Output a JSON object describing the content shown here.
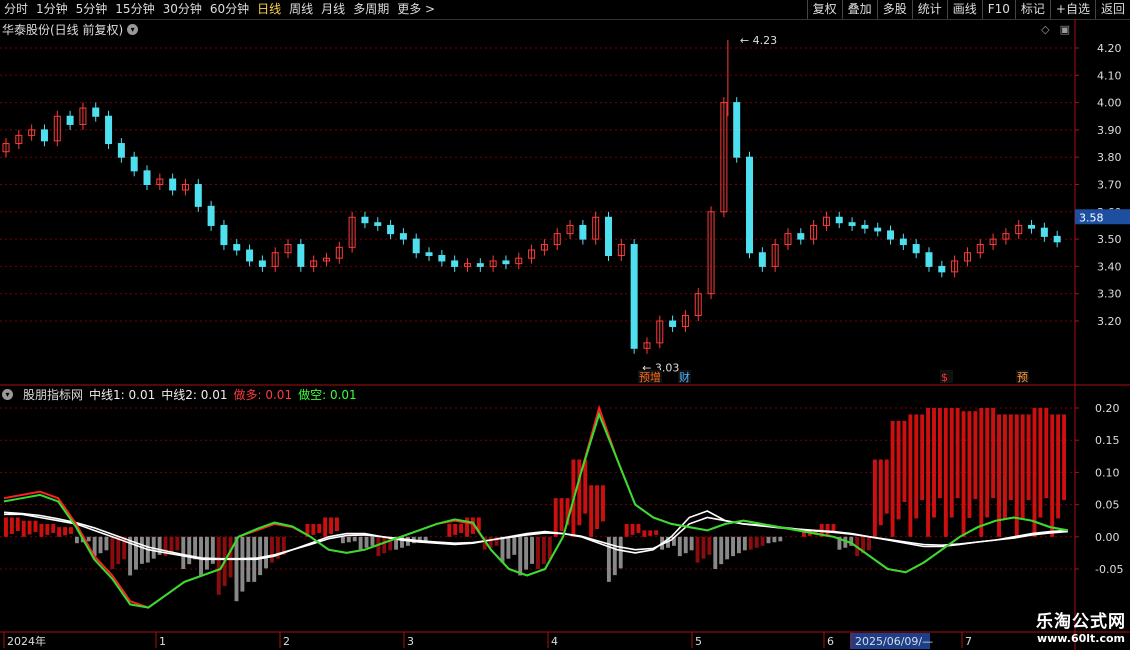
{
  "toolbar": {
    "periods": [
      "分时",
      "1分钟",
      "5分钟",
      "15分钟",
      "30分钟",
      "60分钟",
      "日线",
      "周线",
      "月线",
      "多周期",
      "更多 >"
    ],
    "active_period": "日线",
    "right_buttons": [
      "复权",
      "叠加",
      "多股",
      "统计",
      "画线",
      "F10",
      "标记",
      "+自选",
      "返回"
    ]
  },
  "stock": {
    "title": "华泰股份(日线 前复权)",
    "high_label": "4.23",
    "low_label": "3.03",
    "price_tag": "3.58",
    "event_labels": [
      "预增",
      "财",
      "$",
      "预"
    ],
    "price_axis": [
      "4.20",
      "4.10",
      "4.00",
      "3.90",
      "3.80",
      "3.70",
      "3.60",
      "3.50",
      "3.40",
      "3.30",
      "3.20"
    ]
  },
  "indicator": {
    "name": "股朋指标网",
    "legend": [
      {
        "label": "中线1:",
        "value": "0.01"
      },
      {
        "label": "中线2:",
        "value": "0.01"
      },
      {
        "label": "做多:",
        "value": "0.01"
      },
      {
        "label": "做空:",
        "value": "0.01"
      }
    ],
    "axis": [
      "0.20",
      "0.15",
      "0.10",
      "0.05",
      "0.00",
      "-0.05"
    ]
  },
  "time_axis": {
    "labels": [
      "2024年",
      "1",
      "2",
      "3",
      "4",
      "5",
      "6",
      "2025/06/09/—",
      "7"
    ]
  },
  "watermark": {
    "line1": "乐淘公式网",
    "line2": "www.60lt.com"
  },
  "colors": {
    "up": "#ff3b3b",
    "down": "#4fe0f0",
    "grid": "#7a0000",
    "white_line": "#ffffff",
    "red_line": "#ff2020",
    "green_line": "#30e030",
    "bar_red": "#cc1010",
    "bar_grey": "#888888",
    "dark_red": "#8a0d0d"
  },
  "chart_data": {
    "type": "candlestick",
    "x_axis_ticks": [
      "2024年",
      "1",
      "2",
      "3",
      "4",
      "5",
      "6",
      "7"
    ],
    "price_ylim": [
      3.03,
      4.23
    ],
    "high": 4.23,
    "low": 3.03,
    "last_price": 3.58,
    "close_series": [
      3.85,
      3.88,
      3.9,
      3.86,
      3.95,
      3.92,
      3.98,
      3.95,
      3.85,
      3.8,
      3.75,
      3.7,
      3.72,
      3.68,
      3.7,
      3.62,
      3.55,
      3.48,
      3.46,
      3.42,
      3.4,
      3.45,
      3.48,
      3.4,
      3.42,
      3.43,
      3.47,
      3.58,
      3.56,
      3.55,
      3.52,
      3.5,
      3.45,
      3.44,
      3.42,
      3.4,
      3.41,
      3.4,
      3.42,
      3.41,
      3.43,
      3.46,
      3.48,
      3.52,
      3.55,
      3.5,
      3.58,
      3.44,
      3.48,
      3.1,
      3.12,
      3.2,
      3.18,
      3.22,
      3.3,
      3.6,
      4.0,
      3.8,
      3.45,
      3.4,
      3.48,
      3.52,
      3.5,
      3.55,
      3.58,
      3.56,
      3.55,
      3.54,
      3.53,
      3.5,
      3.48,
      3.45,
      3.4,
      3.38,
      3.42,
      3.45,
      3.48,
      3.5,
      3.52,
      3.55,
      3.54,
      3.51,
      3.49
    ],
    "indicator": {
      "ylim": [
        -0.08,
        0.22
      ],
      "series": [
        {
          "name": "中线1",
          "values": [
            0.035,
            0.035,
            0.03,
            0.025,
            0.02,
            0.01,
            0.0,
            -0.01,
            -0.02,
            -0.025,
            -0.03,
            -0.035,
            -0.035,
            -0.035,
            -0.035,
            -0.03,
            -0.02,
            -0.01,
            0.0,
            0.005,
            0.005,
            0.0,
            -0.005,
            -0.008,
            -0.01,
            -0.012,
            -0.01,
            -0.005,
            0.0,
            0.005,
            0.008,
            0.005,
            0.0,
            -0.01,
            -0.02,
            -0.025,
            -0.02,
            0.0,
            0.03,
            0.04,
            0.025,
            0.02,
            0.018,
            0.015,
            0.012,
            0.01,
            0.008,
            0.005,
            0.0,
            -0.005,
            -0.01,
            -0.015,
            -0.015,
            -0.012,
            -0.008,
            -0.005,
            0.0,
            0.005,
            0.008,
            0.01
          ]
        },
        {
          "name": "中线2",
          "values": [
            0.038,
            0.036,
            0.033,
            0.028,
            0.022,
            0.014,
            0.004,
            -0.006,
            -0.016,
            -0.022,
            -0.028,
            -0.033,
            -0.034,
            -0.034,
            -0.033,
            -0.028,
            -0.02,
            -0.012,
            -0.003,
            0.002,
            0.003,
            0.0,
            -0.003,
            -0.006,
            -0.008,
            -0.01,
            -0.009,
            -0.005,
            -0.001,
            0.003,
            0.006,
            0.005,
            0.001,
            -0.007,
            -0.015,
            -0.02,
            -0.018,
            -0.005,
            0.02,
            0.03,
            0.025,
            0.02,
            0.017,
            0.014,
            0.011,
            0.009,
            0.007,
            0.004,
            0.0,
            -0.004,
            -0.008,
            -0.012,
            -0.013,
            -0.011,
            -0.008,
            -0.005,
            -0.002,
            0.003,
            0.006,
            0.008
          ]
        },
        {
          "name": "做多",
          "values": [
            0.06,
            0.065,
            0.07,
            0.06,
            0.02,
            -0.03,
            -0.06,
            -0.1,
            -0.11,
            -0.09,
            -0.07,
            -0.06,
            -0.05,
            0.0,
            0.01,
            0.02,
            0.015,
            0.0,
            -0.02,
            -0.025,
            -0.02,
            -0.01,
            0.0,
            0.01,
            0.02,
            0.025,
            0.02,
            -0.02,
            -0.05,
            -0.06,
            -0.05,
            0.0,
            0.1,
            0.2,
            0.12,
            0.05,
            0.03,
            0.02,
            0.015,
            0.01,
            0.02,
            0.025,
            0.02,
            0.015,
            0.01,
            0.005,
            0.0,
            -0.01,
            -0.03,
            -0.05,
            -0.055,
            -0.04,
            -0.02,
            0.0,
            0.015,
            0.025,
            0.03,
            0.025,
            0.015,
            0.01
          ]
        },
        {
          "name": "做空",
          "values": [
            0.055,
            0.06,
            0.065,
            0.055,
            0.015,
            -0.035,
            -0.065,
            -0.105,
            -0.11,
            -0.09,
            -0.07,
            -0.06,
            -0.05,
            0.0,
            0.012,
            0.022,
            0.016,
            0.0,
            -0.02,
            -0.025,
            -0.02,
            -0.01,
            0.0,
            0.01,
            0.02,
            0.027,
            0.022,
            -0.02,
            -0.05,
            -0.06,
            -0.05,
            0.0,
            0.1,
            0.19,
            0.12,
            0.05,
            0.03,
            0.02,
            0.015,
            0.01,
            0.02,
            0.025,
            0.02,
            0.015,
            0.01,
            0.005,
            0.0,
            -0.01,
            -0.03,
            -0.05,
            -0.055,
            -0.04,
            -0.02,
            0.0,
            0.015,
            0.025,
            0.03,
            0.025,
            0.015,
            0.01
          ]
        }
      ],
      "histogram": [
        0.03,
        0.025,
        0.02,
        0.015,
        -0.01,
        -0.03,
        -0.05,
        -0.06,
        -0.04,
        -0.03,
        -0.05,
        -0.06,
        -0.09,
        -0.1,
        -0.07,
        -0.04,
        0.0,
        0.02,
        0.03,
        -0.01,
        -0.02,
        -0.03,
        -0.02,
        -0.01,
        0.0,
        0.02,
        0.03,
        -0.02,
        -0.04,
        -0.06,
        -0.05,
        0.06,
        0.12,
        0.08,
        -0.07,
        0.02,
        0.01,
        -0.02,
        -0.03,
        -0.04,
        -0.05,
        -0.03,
        -0.02,
        -0.01,
        0.0,
        0.01,
        0.02,
        -0.02,
        -0.03,
        0.12,
        0.18,
        0.19,
        0.2,
        0.2,
        0.195,
        0.2,
        0.19,
        0.19,
        0.2,
        0.19
      ]
    }
  }
}
